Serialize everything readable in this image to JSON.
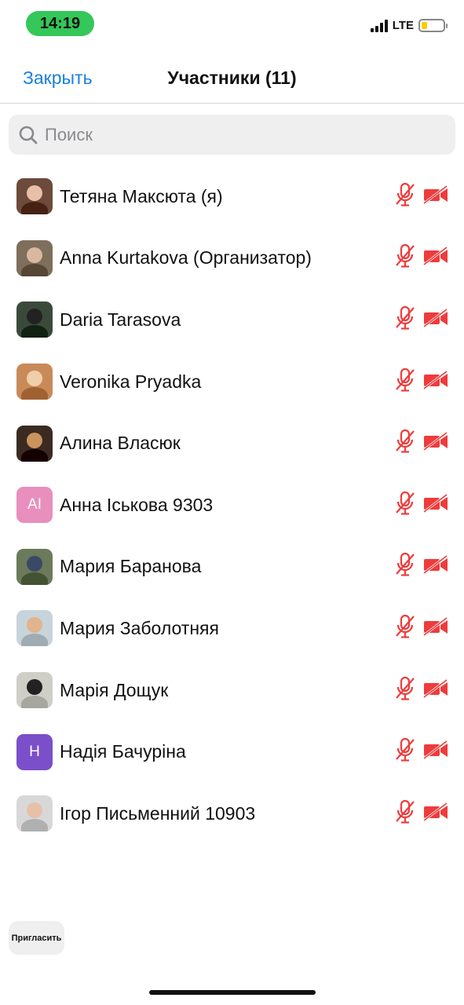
{
  "status_bar": {
    "time": "14:19",
    "network": "LTE",
    "battery_level": 0.25
  },
  "header": {
    "close_label": "Закрыть",
    "title": "Участники (11)"
  },
  "search": {
    "placeholder": "Поиск",
    "value": ""
  },
  "participants": [
    {
      "name": "Тетяна Максюта (я)",
      "avatar": "photo",
      "colors": [
        "#6d4a3c",
        "#e8c0a8"
      ],
      "mic": "muted",
      "video": "off"
    },
    {
      "name": "Anna Kurtakova (Организатор)",
      "avatar": "photo",
      "colors": [
        "#7e6e5c",
        "#d9b8a0"
      ],
      "mic": "muted",
      "video": "off"
    },
    {
      "name": "Daria Tarasova",
      "avatar": "photo",
      "colors": [
        "#3a4a3a",
        "#222222"
      ],
      "mic": "muted",
      "video": "off"
    },
    {
      "name": "Veronika Pryadka",
      "avatar": "photo",
      "colors": [
        "#c98a5a",
        "#f0cfa8"
      ],
      "mic": "muted",
      "video": "off"
    },
    {
      "name": "Алина Власюк",
      "avatar": "photo",
      "colors": [
        "#3b2a22",
        "#c9935e"
      ],
      "mic": "muted",
      "video": "off"
    },
    {
      "name": "Анна Іськова 9303",
      "avatar": "initials",
      "initials": "AI",
      "colors": [
        "#e88fbd"
      ],
      "mic": "muted",
      "video": "off"
    },
    {
      "name": "Мария Баранова",
      "avatar": "photo",
      "colors": [
        "#6a7a5a",
        "#3a4a66"
      ],
      "mic": "muted",
      "video": "off"
    },
    {
      "name": "Мария Заболотняя",
      "avatar": "photo",
      "colors": [
        "#c8d4dc",
        "#e0b48c"
      ],
      "mic": "muted",
      "video": "off"
    },
    {
      "name": "Марія Дощук",
      "avatar": "photo",
      "colors": [
        "#cfcfc8",
        "#222222"
      ],
      "mic": "muted",
      "video": "off"
    },
    {
      "name": "Надія Бачуріна",
      "avatar": "initials",
      "initials": "H",
      "colors": [
        "#7b4fc9"
      ],
      "mic": "muted",
      "video": "off"
    },
    {
      "name": "Ігор Письменний 10903",
      "avatar": "photo",
      "colors": [
        "#d8d8d8",
        "#e7c0a8"
      ],
      "mic": "muted",
      "video": "off"
    }
  ],
  "invite_label": "Пригласить",
  "colors": {
    "accent": "#1a7fe0",
    "muted_red": "#ef3b3b",
    "time_pill": "#34c759"
  }
}
